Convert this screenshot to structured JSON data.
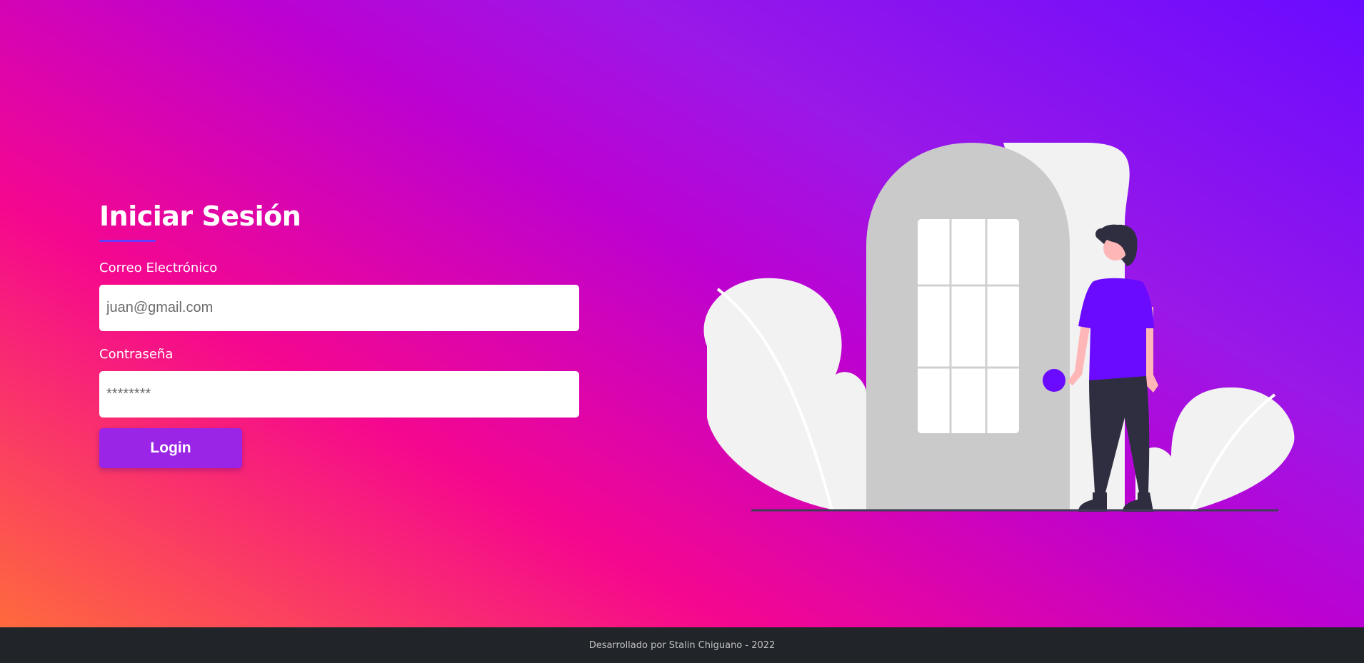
{
  "login": {
    "title": "Iniciar Sesión",
    "email_label": "Correo Electrónico",
    "email_placeholder": "juan@gmail.com",
    "email_value": "",
    "password_label": "Contraseña",
    "password_placeholder": "********",
    "password_value": "",
    "submit_label": "Login"
  },
  "illustration": {
    "icon": "person-at-door-illustration"
  },
  "footer": {
    "text": "Desarrollado por Stalin Chiguano - 2022"
  },
  "colors": {
    "accent": "#9b25e6",
    "underline": "#6a3bff",
    "shirt": "#6a0bff",
    "footer_bg": "#212529"
  }
}
